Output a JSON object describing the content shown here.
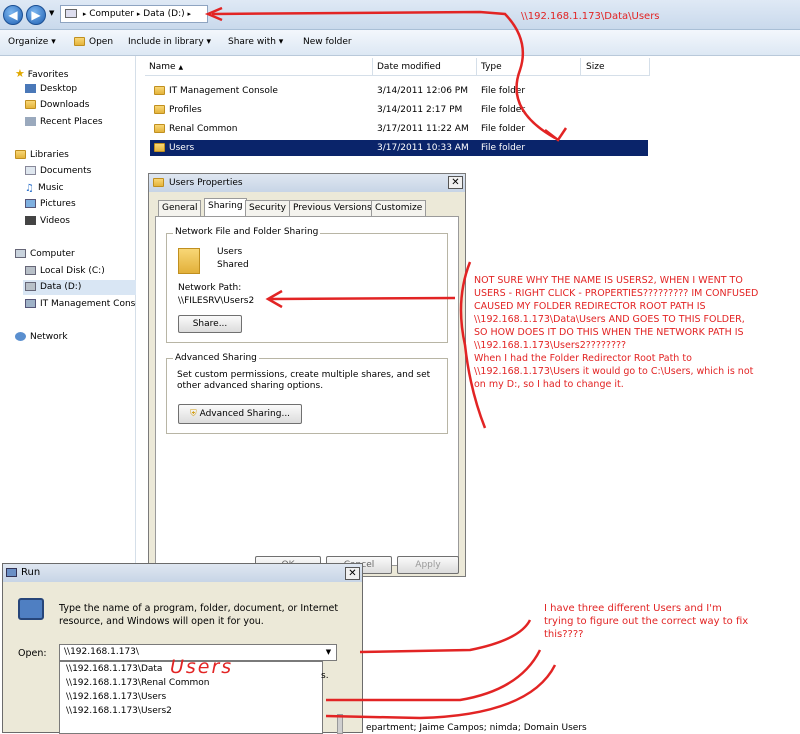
{
  "address_bar": {
    "crumbs": [
      "Computer",
      "Data (D:)"
    ]
  },
  "toolbar": {
    "organize": "Organize",
    "open": "Open",
    "include_in_library": "Include in library",
    "share_with": "Share with",
    "new_folder": "New folder"
  },
  "nav_pane": {
    "favorites": "Favorites",
    "favorites_items": [
      "Desktop",
      "Downloads",
      "Recent Places"
    ],
    "libraries": "Libraries",
    "libraries_items": [
      "Documents",
      "Music",
      "Pictures",
      "Videos"
    ],
    "computer": "Computer",
    "computer_items": [
      "Local Disk (C:)",
      "Data (D:)",
      "IT Management Consc"
    ],
    "network": "Network"
  },
  "file_list": {
    "columns": [
      "Name",
      "Date modified",
      "Type",
      "Size"
    ],
    "rows": [
      {
        "name": "IT Management Console",
        "date": "3/14/2011 12:06 PM",
        "type": "File folder",
        "size": ""
      },
      {
        "name": "Profiles",
        "date": "3/14/2011 2:17 PM",
        "type": "File folder",
        "size": ""
      },
      {
        "name": "Renal Common",
        "date": "3/17/2011 11:22 AM",
        "type": "File folder",
        "size": ""
      },
      {
        "name": "Users",
        "date": "3/17/2011 10:33 AM",
        "type": "File folder",
        "size": "",
        "selected": true
      }
    ]
  },
  "properties_dialog": {
    "title": "Users Properties",
    "tabs": [
      "General",
      "Sharing",
      "Security",
      "Previous Versions",
      "Customize"
    ],
    "active_tab": "Sharing",
    "network_sharing_label": "Network File and Folder Sharing",
    "share_name": "Users",
    "share_status": "Shared",
    "network_path_label": "Network Path:",
    "network_path_value": "\\\\FILESRV\\Users2",
    "share_button": "Share...",
    "advanced_label": "Advanced Sharing",
    "advanced_desc": "Set custom permissions, create multiple shares, and set other advanced sharing options.",
    "advanced_button": "Advanced Sharing...",
    "ok": "OK",
    "cancel": "Cancel",
    "apply": "Apply"
  },
  "run_dialog": {
    "title": "Run",
    "desc": "Type the name of a program, folder, document, or Internet resource, and Windows will open it for you.",
    "open_label": "Open:",
    "open_value": "\\\\192.168.1.173\\",
    "suggestions": [
      "\\\\192.168.1.173\\Data",
      "\\\\192.168.1.173\\Renal Common",
      "\\\\192.168.1.173\\Users",
      "\\\\192.168.1.173\\Users2"
    ],
    "obscured_text": "s.",
    "bottom_text": "epartment; Jaime Campos; nimda; Domain Users"
  },
  "annotations": {
    "path_note": "\\\\192.168.1.173\\Data\\Users",
    "users_scribble": "Users",
    "main_note": "NOT SURE WHY THE NAME IS USERS2, WHEN I WENT TO USERS - RIGHT CLICK - PROPERTIES????????? IM CONFUSED CAUSED MY FOLDER REDIRECTOR ROOT PATH IS \\\\192.168.1.173\\Data\\Users AND GOES TO THIS FOLDER, SO HOW DOES IT DO THIS WHEN THE NETWORK PATH IS \\\\192.168.1.173\\Users2????????",
    "main_note_2": "When I had the Folder Redirector Root Path to \\\\192.168.1.173\\Users it would go to C:\\Users, which is not on my D:, so I had to change it.",
    "bottom_note": "I have three different Users and I'm trying to figure out the correct way to fix this????",
    "colors": {
      "annotation": "#e22424",
      "selection": "#0a246a"
    }
  }
}
